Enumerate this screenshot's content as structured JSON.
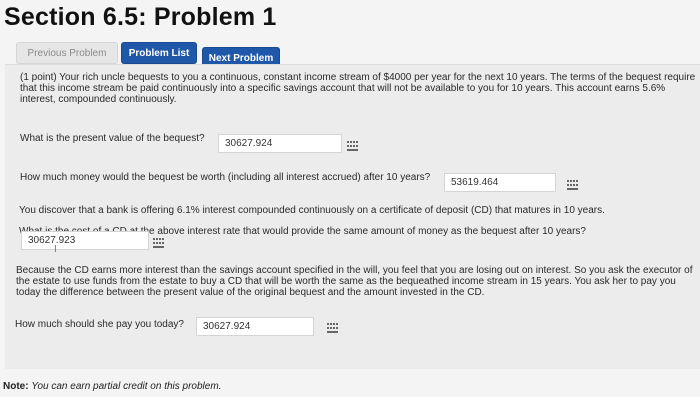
{
  "page_title": "Section 6.5: Problem 1",
  "nav": {
    "previous": "Previous Problem",
    "list": "Problem List",
    "next": "Next Problem"
  },
  "problem": {
    "intro_line1": "(1 point) Your rich uncle bequests to you a continuous, constant income stream of $4000 per year for the next 10 years. The terms of the bequest require",
    "intro_line2": "that this income stream be paid continuously into a specific savings account that will not be available to you for 10 years. This account earns 5.6%",
    "intro_line3": "interest, compounded continuously.",
    "q1": "What is the present value of the bequest?",
    "a1": "30627.924",
    "q2": "How much money would the bequest be worth (including all interest accrued) after 10 years?",
    "a2": "53619.464",
    "discover": "You discover that a bank is offering 6.1% interest compounded continuously on a certificate of deposit (CD) that matures in 10 years.",
    "q3": "What is the cost of a CD at the above interest rate that would provide the same amount of money as the bequest after 10 years?",
    "a3": "30627.923",
    "because_line1": "Because the CD earns more interest than the savings account specified in the will, you feel that you are losing out on interest. So you ask the executor of",
    "because_line2": "the estate to use funds from the estate to buy a CD that will be worth the same as the bequeathed income stream in 15 years. You ask her to pay you",
    "because_line3": "today the difference between the present value of the original bequest and the amount invested in the CD.",
    "q4": "How much should she pay you today?",
    "a4": "30627.924"
  },
  "note": {
    "label": "Note:",
    "text": "You can earn partial credit on this problem."
  },
  "icons": {
    "answer_tool": "grid-icon"
  }
}
